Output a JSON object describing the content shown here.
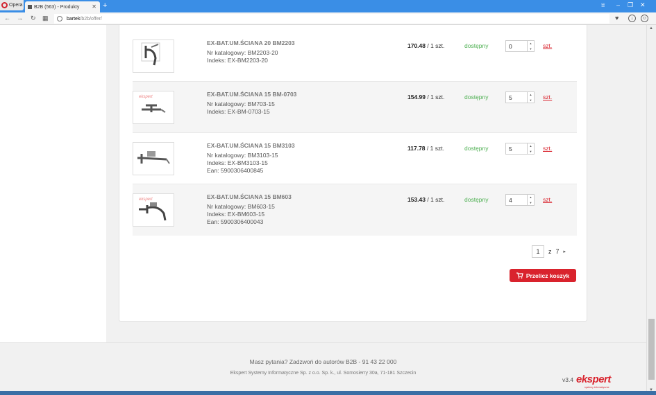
{
  "browser": {
    "menu_label": "Opera",
    "tab_title": "B2B (563) - Produkty",
    "url_host": "bartek",
    "url_path": "/b2b/offer/"
  },
  "products": [
    {
      "name": "EX-BAT.UM.ŚCIANA 20 BM2203",
      "catalog": "Nr katalogowy: BM2203-20",
      "index": "Indeks: EX-BM2203-20",
      "ean": "",
      "price": "170.48",
      "per": " / 1 szt.",
      "stock": "dostępny",
      "qty": "0",
      "unit": "szt."
    },
    {
      "name": "EX-BAT.UM.ŚCIANA 15 BM-0703",
      "catalog": "Nr katalogowy: BM703-15",
      "index": "Indeks: EX-BM-0703-15",
      "ean": "",
      "price": "154.99",
      "per": " / 1 szt.",
      "stock": "dostępny",
      "qty": "5",
      "unit": "szt."
    },
    {
      "name": "EX-BAT.UM.ŚCIANA 15 BM3103",
      "catalog": "Nr katalogowy: BM3103-15",
      "index": "Indeks: EX-BM3103-15",
      "ean": "Ean: 5900306400845",
      "price": "117.78",
      "per": " / 1 szt.",
      "stock": "dostępny",
      "qty": "5",
      "unit": "szt."
    },
    {
      "name": "EX-BAT.UM.ŚCIANA 15 BM603",
      "catalog": "Nr katalogowy: BM603-15",
      "index": "Indeks: EX-BM603-15",
      "ean": "Ean: 5900306400043",
      "price": "153.43",
      "per": " / 1 szt.",
      "stock": "dostępny",
      "qty": "4",
      "unit": "szt."
    }
  ],
  "pagination": {
    "current": "1",
    "of": "z",
    "total": "7",
    "next": "▸"
  },
  "recalc_button": "Przelicz koszyk",
  "footer": {
    "question": "Masz pytania? Zadzwoń do autorów B2B - 91 43 22 000",
    "company": "Ekspert Systemy Informatyczne Sp. z o.o. Sp. k., ul. Somosierry 30a, 71-181 Szczecin",
    "version": "v3.4",
    "logo": "ekspert",
    "logo_tagline": "systemy informatyczne"
  },
  "colors": {
    "accent": "#d9232d",
    "stock": "#4caf50",
    "tabbar": "#3a8ee6"
  }
}
